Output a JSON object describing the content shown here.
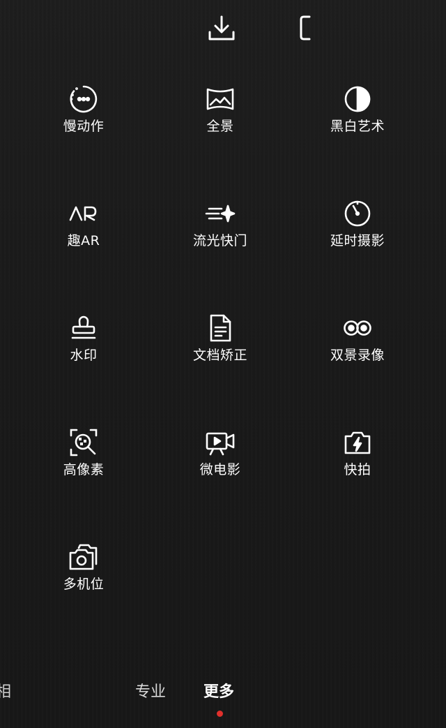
{
  "modes": [
    [
      {
        "label": "慢动作",
        "icon": "slow-motion-icon"
      },
      {
        "label": "全景",
        "icon": "panorama-icon"
      },
      {
        "label": "黑白艺术",
        "icon": "monochrome-icon"
      }
    ],
    [
      {
        "label": "趣AR",
        "icon": "ar-icon"
      },
      {
        "label": "流光快门",
        "icon": "light-painting-icon"
      },
      {
        "label": "延时摄影",
        "icon": "timelapse-icon"
      }
    ],
    [
      {
        "label": "水印",
        "icon": "watermark-stamp-icon"
      },
      {
        "label": "文档矫正",
        "icon": "document-icon"
      },
      {
        "label": "双景录像",
        "icon": "dual-view-icon"
      }
    ],
    [
      {
        "label": "高像素",
        "icon": "high-resolution-icon"
      },
      {
        "label": "微电影",
        "icon": "micro-movie-icon"
      },
      {
        "label": "快拍",
        "icon": "quick-snap-icon"
      }
    ],
    [
      {
        "label": "多机位",
        "icon": "multi-camera-icon"
      }
    ]
  ],
  "bottom_tabs": {
    "partial": "相",
    "pro": "专业",
    "more": "更多"
  },
  "colors": {
    "background": "#1a1a1a",
    "text": "#ffffff",
    "active_indicator": "#e0302c"
  }
}
